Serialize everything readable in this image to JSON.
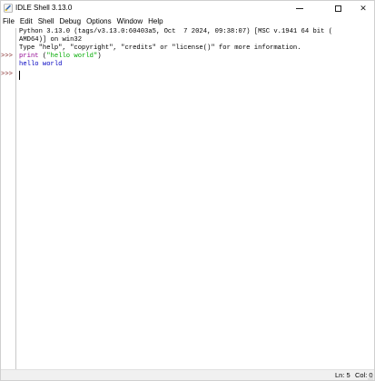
{
  "window": {
    "title": "IDLE Shell 3.13.0",
    "app_icon": "python-idle-icon",
    "controls": {
      "minimize_icon": "minimize-icon",
      "maximize_icon": "maximize-icon",
      "close_glyph": "✕"
    }
  },
  "menu": {
    "items": [
      {
        "label": "File"
      },
      {
        "label": "Edit"
      },
      {
        "label": "Shell"
      },
      {
        "label": "Debug"
      },
      {
        "label": "Options"
      },
      {
        "label": "Window"
      },
      {
        "label": "Help"
      }
    ]
  },
  "shell": {
    "lines": [
      {
        "text": "Python 3.13.0 (tags/v3.13.0:60403a5, Oct  7 2024, 09:38:07) [MSC v.1941 64 bit ("
      },
      {
        "text": "AMD64)] on win32"
      },
      {
        "text": "Type \"help\", \"copyright\", \"credits\" or \"license()\" for more information."
      }
    ],
    "prompt": ">>>",
    "command": {
      "keyword": "print",
      "open": " (",
      "string": "\"hello world\"",
      "close": ")"
    },
    "output": "hello world"
  },
  "colors": {
    "prompt": "#7c1d1d",
    "keyword": "#900090",
    "string": "#00aa00",
    "output": "#0000c0"
  },
  "status": {
    "ln": "Ln: 5",
    "col": "Col: 0"
  }
}
